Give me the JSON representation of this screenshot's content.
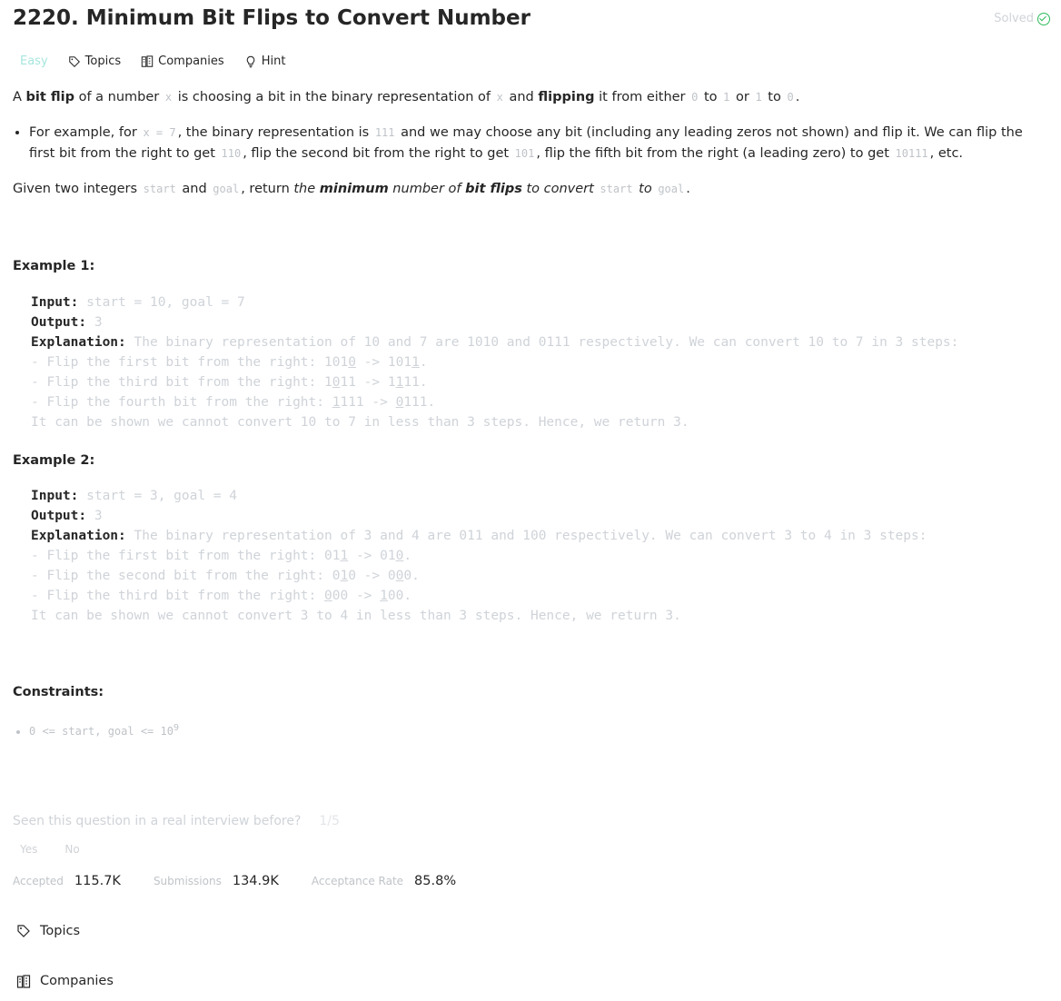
{
  "problem": {
    "title": "2220. Minimum Bit Flips to Convert Number",
    "solved_label": "Solved",
    "difficulty": "Easy",
    "tags": {
      "topics": "Topics",
      "companies": "Companies",
      "hint": "Hint"
    }
  },
  "description": {
    "p1": {
      "t1": "A ",
      "b1": "bit flip",
      "t2": " of a number ",
      "c1": "x",
      "t3": " is choosing a bit in the binary representation of ",
      "c2": "x",
      "t4": " and ",
      "b2": "flipping",
      "t5": " it from either ",
      "c3": "0",
      "t6": " to ",
      "c4": "1",
      "t7": " or ",
      "c5": "1",
      "t8": " to ",
      "c6": "0",
      "t9": "."
    },
    "bullet": {
      "t1": "For example, for ",
      "c1": "x = 7",
      "t2": ", the binary representation is ",
      "c2": "111",
      "t3": " and we may choose any bit (including any leading zeros not shown) and flip it. We can flip the first bit from the right to get ",
      "c3": "110",
      "t4": ", flip the second bit from the right to get ",
      "c4": "101",
      "t5": ", flip the fifth bit from the right (a leading zero) to get ",
      "c5": "10111",
      "t6": ", etc."
    },
    "given": {
      "t1": "Given two integers ",
      "c1": "start",
      "t2": " and ",
      "c2": "goal",
      "t3": ", return ",
      "e1": "the ",
      "b1": "minimum",
      "e2": " number of ",
      "b2": "bit flips",
      "e3": " to convert ",
      "c3": "start",
      "e4": " to ",
      "c4": "goal",
      "t4": "."
    }
  },
  "examples": [
    {
      "title": "Example 1:",
      "input_label": "Input:",
      "input": "start = 10, goal = 7",
      "output_label": "Output:",
      "output": "3",
      "expl_label": "Explanation:",
      "expl": "The binary representation of 10 and 7 are 1010 and 0111 respectively. We can convert 10 to 7 in 3 steps:",
      "steps": [
        {
          "pre": "- Flip the first bit from the right: ",
          "a1": "101",
          "a2": "0",
          "mid": " -> ",
          "b1": "101",
          "b2": "1",
          "end": "."
        },
        {
          "pre": "- Flip the third bit from the right: ",
          "a1": "1",
          "a2": "0",
          "a3": "11",
          "mid": " -> ",
          "b1": "1",
          "b2": "1",
          "b3": "11",
          "end": "."
        },
        {
          "pre": "- Flip the fourth bit from the right: ",
          "a1": "",
          "a2": "1",
          "a3": "111",
          "mid": " -> ",
          "b1": "",
          "b2": "0",
          "b3": "111",
          "end": "."
        }
      ],
      "conclusion": "It can be shown we cannot convert 10 to 7 in less than 3 steps. Hence, we return 3."
    },
    {
      "title": "Example 2:",
      "input_label": "Input:",
      "input": "start = 3, goal = 4",
      "output_label": "Output:",
      "output": "3",
      "expl_label": "Explanation:",
      "expl": "The binary representation of 3 and 4 are 011 and 100 respectively. We can convert 3 to 4 in 3 steps:",
      "steps": [
        {
          "pre": "- Flip the first bit from the right: ",
          "a1": "01",
          "a2": "1",
          "mid": " -> ",
          "b1": "01",
          "b2": "0",
          "end": "."
        },
        {
          "pre": "- Flip the second bit from the right: ",
          "a1": "0",
          "a2": "1",
          "a3": "0",
          "mid": " -> ",
          "b1": "0",
          "b2": "0",
          "b3": "0",
          "end": "."
        },
        {
          "pre": "- Flip the third bit from the right: ",
          "a1": "",
          "a2": "0",
          "a3": "00",
          "mid": " -> ",
          "b1": "",
          "b2": "1",
          "b3": "00",
          "end": "."
        }
      ],
      "conclusion": "It can be shown we cannot convert 3 to 4 in less than 3 steps. Hence, we return 3."
    }
  ],
  "constraints": {
    "title": "Constraints:",
    "items": [
      {
        "text": "0 <= start, goal <= 10",
        "sup": "9"
      }
    ]
  },
  "interview": {
    "question": "Seen this question in a real interview before?",
    "count": "1/5",
    "yes": "Yes",
    "no": "No"
  },
  "stats": {
    "accepted_label": "Accepted",
    "accepted": "115.7K",
    "submissions_label": "Submissions",
    "submissions": "134.9K",
    "rate_label": "Acceptance Rate",
    "rate": "85.8%"
  },
  "sections": {
    "topics": "Topics",
    "companies": "Companies"
  },
  "icons": {
    "solved": "check-circle-icon",
    "topics": "tag-icon",
    "companies": "building-icon",
    "hint": "lightbulb-icon"
  },
  "colors": {
    "easy": "#00b8a3",
    "solved": "#2cbb5d"
  }
}
